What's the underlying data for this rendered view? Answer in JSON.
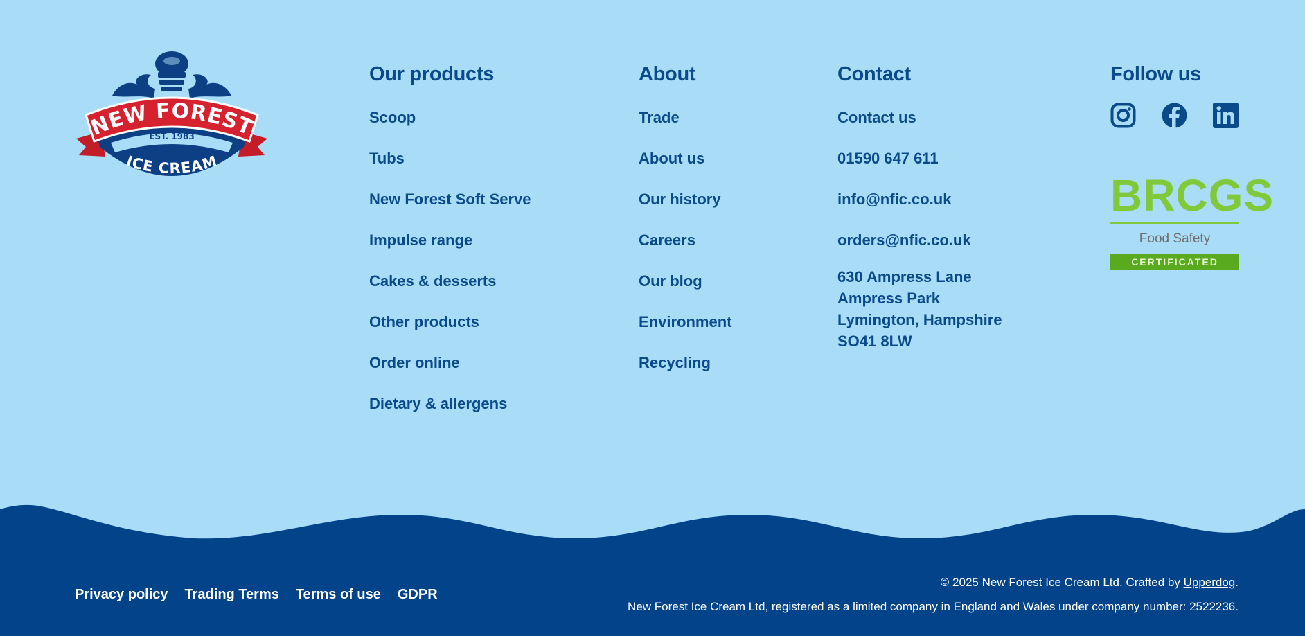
{
  "brand": {
    "logo_top": "NEW FOREST",
    "logo_est": "EST. 1983",
    "logo_bottom": "ICE CREAM"
  },
  "columns": {
    "products": {
      "heading": "Our products",
      "items": [
        "Scoop",
        "Tubs",
        "New Forest Soft Serve",
        "Impulse range",
        "Cakes & desserts",
        "Other products",
        "Order online",
        "Dietary & allergens"
      ]
    },
    "about": {
      "heading": "About",
      "items": [
        "Trade",
        "About us",
        "Our history",
        "Careers",
        "Our blog",
        "Environment",
        "Recycling"
      ]
    },
    "contact": {
      "heading": "Contact",
      "items": [
        "Contact us",
        "01590 647 611",
        "info@nfic.co.uk",
        "orders@nfic.co.uk"
      ],
      "address": [
        "630 Ampress Lane",
        "Ampress Park",
        "Lymington, Hampshire",
        "SO41 8LW"
      ]
    },
    "follow": {
      "heading": "Follow us",
      "icons": [
        "instagram-icon",
        "facebook-icon",
        "linkedin-icon"
      ]
    }
  },
  "badge": {
    "title": "BRCGS",
    "subtitle": "Food Safety",
    "label": "CERTIFICATED"
  },
  "footer": {
    "links": [
      "Privacy policy",
      "Trading Terms",
      "Terms of use",
      "GDPR"
    ],
    "copyright_prefix": "© 2025 New Forest Ice Cream Ltd. Crafted by ",
    "crafted_by": "Upperdog",
    "copyright_suffix": ".",
    "registration": "New Forest Ice Cream Ltd, registered as a limited company in England and Wales under company number: 2522236."
  },
  "colors": {
    "background": "#a9dcf6",
    "primary": "#0a4a8a",
    "footer": "#024389",
    "logo_red": "#d6222f",
    "badge_green": "#7fc93a"
  }
}
